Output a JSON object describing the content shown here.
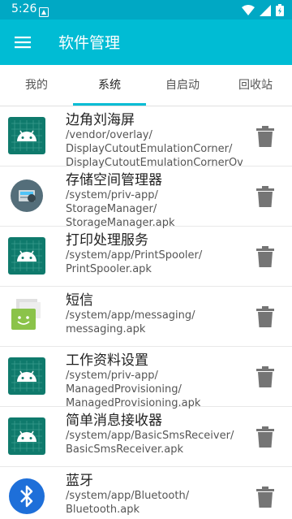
{
  "status_bar": {
    "time": "5:26"
  },
  "app_bar": {
    "title": "软件管理"
  },
  "tabs": [
    {
      "label": "我的",
      "active": false
    },
    {
      "label": "系统",
      "active": true
    },
    {
      "label": "自启动",
      "active": false
    },
    {
      "label": "回收站",
      "active": false
    }
  ],
  "apps": [
    {
      "name": "边角刘海屏",
      "path": "/vendor/overlay/\nDisplayCutoutEmulationCorner/\nDisplayCutoutEmulationCornerOve",
      "icon": "android-icon"
    },
    {
      "name": "存储空间管理器",
      "path": "/system/priv-app/\nStorageManager/\nStorageManager.apk",
      "icon": "storage-icon"
    },
    {
      "name": "打印处理服务",
      "path": "/system/app/PrintSpooler/\nPrintSpooler.apk",
      "icon": "android-icon"
    },
    {
      "name": "短信",
      "path": "/system/app/messaging/\nmessaging.apk",
      "icon": "messaging-icon"
    },
    {
      "name": "工作资料设置",
      "path": "/system/priv-app/\nManagedProvisioning/\nManagedProvisioning.apk",
      "icon": "android-icon"
    },
    {
      "name": "简单消息接收器",
      "path": "/system/app/BasicSmsReceiver/\nBasicSmsReceiver.apk",
      "icon": "android-icon"
    },
    {
      "name": "蓝牙",
      "path": "/system/app/Bluetooth/\nBluetooth.apk",
      "icon": "bluetooth-icon"
    }
  ],
  "colors": {
    "accent": "#00bcd4",
    "status": "#00a8c4",
    "android_tile": "#0f7a6c"
  }
}
